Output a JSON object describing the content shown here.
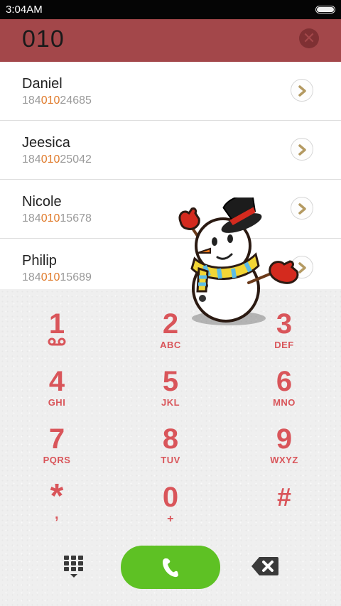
{
  "status_bar": {
    "time": "3:04AM"
  },
  "dial_input": {
    "number": "010",
    "clear_icon": "clear-icon"
  },
  "contacts": [
    {
      "name": "Daniel",
      "phone_prefix": "184",
      "phone_match": "010",
      "phone_suffix": "24685"
    },
    {
      "name": "Jeesica",
      "phone_prefix": "184",
      "phone_match": "010",
      "phone_suffix": "25042"
    },
    {
      "name": "Nicole",
      "phone_prefix": "184",
      "phone_match": "010",
      "phone_suffix": "15678"
    },
    {
      "name": "Philip",
      "phone_prefix": "184",
      "phone_match": "010",
      "phone_suffix": "15689"
    }
  ],
  "keypad": [
    {
      "digit": "1",
      "letters": ""
    },
    {
      "digit": "2",
      "letters": "ABC"
    },
    {
      "digit": "3",
      "letters": "DEF"
    },
    {
      "digit": "4",
      "letters": "GHI"
    },
    {
      "digit": "5",
      "letters": "JKL"
    },
    {
      "digit": "6",
      "letters": "MNO"
    },
    {
      "digit": "7",
      "letters": "PQRS"
    },
    {
      "digit": "8",
      "letters": "TUV"
    },
    {
      "digit": "9",
      "letters": "WXYZ"
    },
    {
      "digit": "*",
      "letters": ","
    },
    {
      "digit": "0",
      "letters": "+"
    },
    {
      "digit": "#",
      "letters": ""
    }
  ],
  "icons": {
    "voicemail": "voicemail-icon",
    "keypad_toggle": "keypad-grid-icon",
    "call": "phone-icon",
    "delete": "backspace-icon",
    "decoration": "snowman-icon"
  },
  "colors": {
    "header": "#a3474a",
    "key_text": "#d9555a",
    "match_highlight": "#e07b2c",
    "call_button": "#5ec124"
  }
}
